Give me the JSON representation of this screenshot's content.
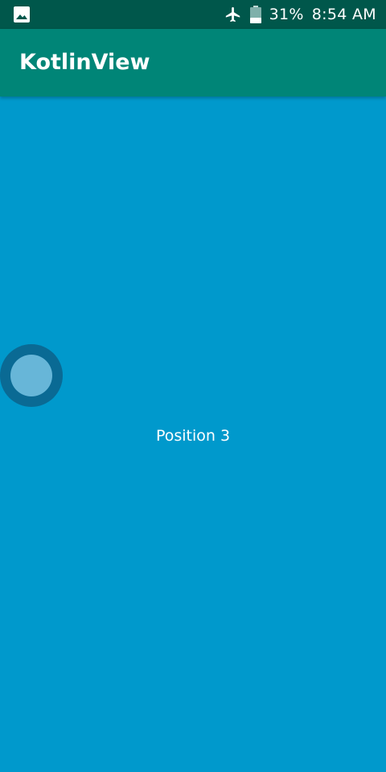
{
  "status_bar": {
    "notification_icon": "image-icon",
    "airplane_icon": "airplane-icon",
    "battery_icon": "battery-icon",
    "battery_percent": "31%",
    "time": "8:54 AM"
  },
  "app_bar": {
    "title": "KotlinView"
  },
  "content": {
    "label": "Position 3",
    "background_color": "#0099cc"
  },
  "colors": {
    "status_bar": "#00574b",
    "app_bar": "#008577",
    "content": "#0099cc"
  }
}
